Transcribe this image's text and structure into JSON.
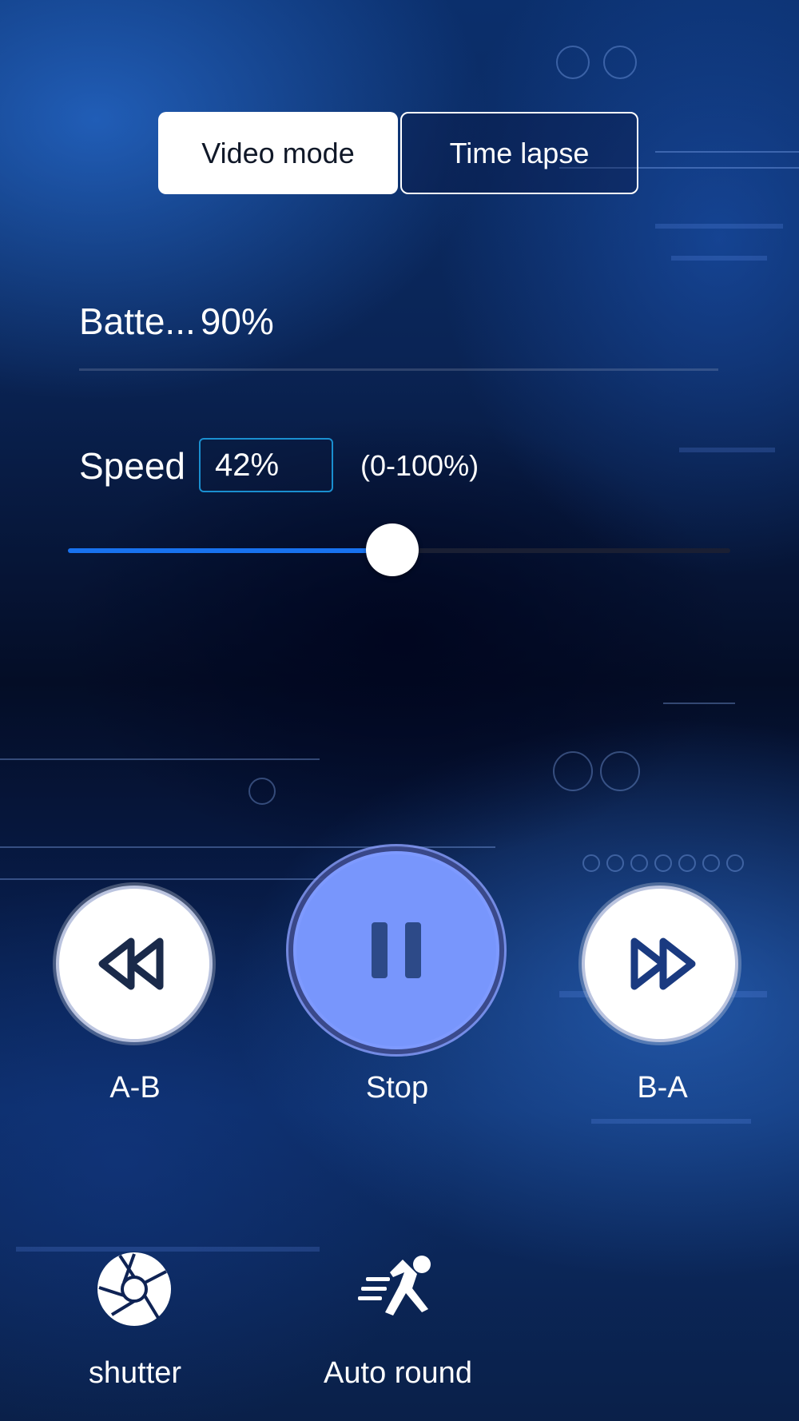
{
  "modes": {
    "video_mode_label": "Video mode",
    "time_lapse_label": "Time lapse",
    "active": "video_mode"
  },
  "battery": {
    "label": "Batte...",
    "value": "90%"
  },
  "speed": {
    "label": "Speed",
    "value": "42%",
    "range_hint": "(0-100%)",
    "slider_fraction": 0.49
  },
  "controls": {
    "rewind_label": "A-B",
    "pause_label": "Stop",
    "forward_label": "B-A",
    "rewind_icon": "rewind-icon",
    "pause_icon": "pause-icon",
    "forward_icon": "fast-forward-icon"
  },
  "bottom_actions": {
    "shutter_label": "shutter",
    "shutter_icon": "shutter-icon",
    "auto_round_label": "Auto round",
    "auto_round_icon": "running-person-icon"
  },
  "colors": {
    "accent_blue": "#1872ef",
    "pause_button": "#7896fc",
    "icon_dark": "#1a2a4a"
  }
}
